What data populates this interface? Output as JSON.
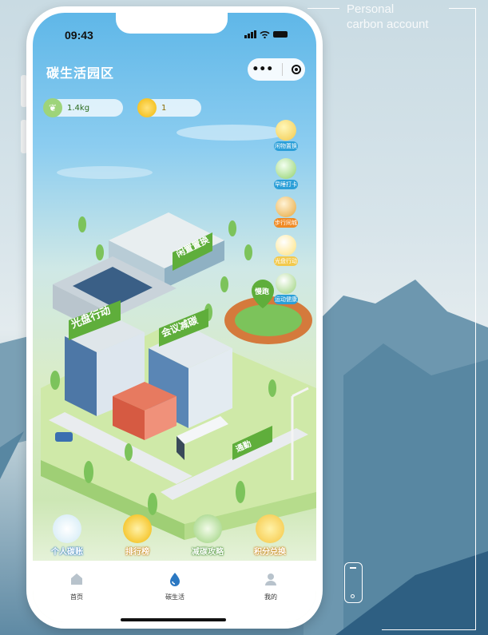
{
  "caption": {
    "line1": "Personal",
    "line2": "carbon account"
  },
  "status_bar": {
    "time": "09:43"
  },
  "app": {
    "title": "碳生活园区",
    "capsule": {
      "more": "•••"
    }
  },
  "stats": {
    "carbon": "1.4kg",
    "coins": "1"
  },
  "side_menu": [
    {
      "label": "闲物置换",
      "icon": "basket-icon"
    },
    {
      "label": "早睡打卡",
      "icon": "flag-icon"
    },
    {
      "label": "步行同城",
      "icon": "shoes-icon"
    },
    {
      "label": "光盘行动",
      "icon": "plate-icon"
    },
    {
      "label": "运动健康",
      "icon": "running-icon"
    }
  ],
  "map_signs": {
    "idle_exchange": "闲置置换",
    "clean_plate": "光盘行动",
    "meeting": "会议减碳",
    "run": "慢跑",
    "bus": "通勤"
  },
  "actions": [
    {
      "label": "个人碳账",
      "icon": "ledger-icon"
    },
    {
      "label": "排行榜",
      "icon": "trophy-icon"
    },
    {
      "label": "减碳攻略",
      "icon": "guide-icon"
    },
    {
      "label": "积分兑换",
      "icon": "exchange-icon"
    }
  ],
  "tabs": [
    {
      "label": "首页",
      "icon": "home-icon"
    },
    {
      "label": "碳生活",
      "icon": "drop-icon"
    },
    {
      "label": "我的",
      "icon": "user-icon"
    }
  ],
  "colors": {
    "accent": "#2b9fd8",
    "green": "#5fae3b",
    "sky": "#5fb7e8"
  }
}
